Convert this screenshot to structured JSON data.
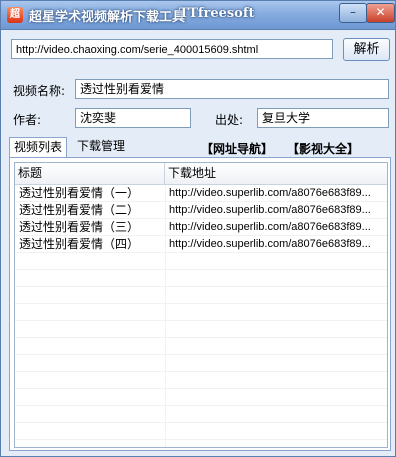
{
  "window": {
    "title": "超星学术视频解析下载工具",
    "brand": "TTfreesoft",
    "app_icon": "app-logo-icon",
    "min_label": "–",
    "close_label": "✕"
  },
  "url_bar": {
    "value": "http://video.chaoxing.com/serie_400015609.shtml",
    "button": "解析"
  },
  "info": {
    "name_label": "视频名称:",
    "name_value": "透过性别看爱情",
    "author_label": "作者:",
    "author_value": "沈奕斐",
    "source_label": "出处:",
    "source_value": "复旦大学"
  },
  "tabs": [
    {
      "label": "视频列表",
      "active": true
    },
    {
      "label": "下载管理",
      "active": false
    }
  ],
  "links": {
    "nav": "【网址导航】",
    "videos": "【影视大全】"
  },
  "table": {
    "headers": [
      "标题",
      "下载地址"
    ],
    "rows": [
      {
        "title": "透过性别看爱情（一）",
        "url": "http://video.superlib.com/a8076e683f89..."
      },
      {
        "title": "透过性别看爱情（二）",
        "url": "http://video.superlib.com/a8076e683f89..."
      },
      {
        "title": "透过性别看爱情（三）",
        "url": "http://video.superlib.com/a8076e683f89..."
      },
      {
        "title": "透过性别看爱情（四）",
        "url": "http://video.superlib.com/a8076e683f89..."
      }
    ]
  },
  "colors": {
    "titlebar": "#86acdf",
    "window_bg": "#e3ecf7",
    "close": "#c8402a"
  }
}
